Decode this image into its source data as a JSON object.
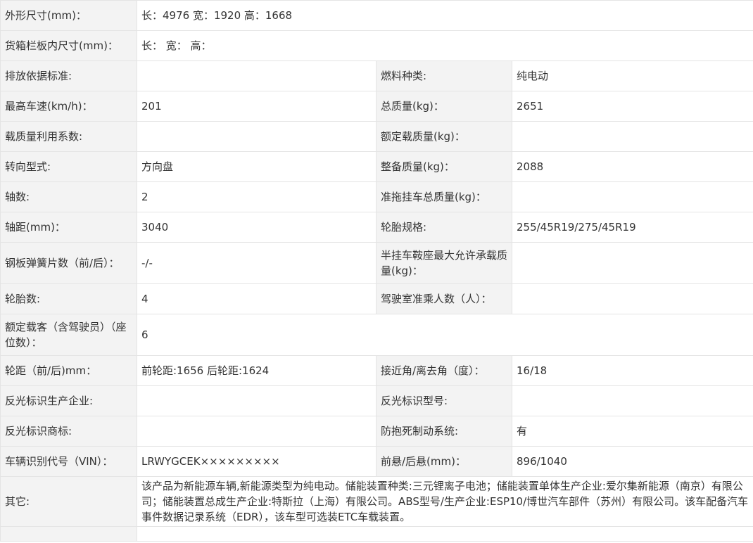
{
  "rows": [
    {
      "type": "span",
      "label": "外形尺寸(mm)：",
      "value": "长：4976 宽：1920 高：1668"
    },
    {
      "type": "span",
      "label": "货箱栏板内尺寸(mm)：",
      "value": "长： 宽： 高："
    },
    {
      "type": "pair",
      "label1": "排放依据标准:",
      "value1": "",
      "label2": "燃料种类:",
      "value2": "纯电动"
    },
    {
      "type": "pair",
      "label1": "最高车速(km/h)：",
      "value1": "201",
      "label2": "总质量(kg)：",
      "value2": "2651"
    },
    {
      "type": "pair",
      "label1": "载质量利用系数:",
      "value1": "",
      "label2": "额定载质量(kg)：",
      "value2": ""
    },
    {
      "type": "pair",
      "label1": "转向型式:",
      "value1": "方向盘",
      "label2": "整备质量(kg)：",
      "value2": "2088"
    },
    {
      "type": "pair",
      "label1": "轴数:",
      "value1": "2",
      "label2": "准拖挂车总质量(kg)：",
      "value2": ""
    },
    {
      "type": "pair",
      "label1": "轴距(mm)：",
      "value1": "3040",
      "label2": "轮胎规格:",
      "value2": "255/45R19/275/45R19"
    },
    {
      "type": "pair",
      "tall": true,
      "label1": "钢板弹簧片数（前/后）：",
      "value1": "-/-",
      "label2": "半挂车鞍座最大允许承载质量(kg)：",
      "value2": ""
    },
    {
      "type": "pair",
      "label1": "轮胎数:",
      "value1": "4",
      "label2": "驾驶室准乘人数（人）：",
      "value2": ""
    },
    {
      "type": "span",
      "tall": true,
      "label": "额定载客（含驾驶员）（座位数）：",
      "value": "6"
    },
    {
      "type": "pair",
      "label1": "轮距（前/后)mm：",
      "value1": "前轮距:1656 后轮距:1624",
      "label2": "接近角/离去角（度）：",
      "value2": "16/18"
    },
    {
      "type": "pair",
      "label1": "反光标识生产企业:",
      "value1": "",
      "label2": "反光标识型号:",
      "value2": ""
    },
    {
      "type": "pair",
      "label1": "反光标识商标:",
      "value1": "",
      "label2": "防抱死制动系统:",
      "value2": "有"
    },
    {
      "type": "pair",
      "label1": "车辆识别代号（VIN）：",
      "value1": "LRWYGCEK×××××××××",
      "label2": "前悬/后悬(mm)：",
      "value2": "896/1040"
    },
    {
      "type": "span",
      "taller": true,
      "label": "其它:",
      "value": "该产品为新能源车辆,新能源类型为纯电动。储能装置种类:三元锂离子电池；储能装置单体生产企业:爱尔集新能源（南京）有限公司；储能装置总成生产企业:特斯拉（上海）有限公司。ABS型号/生产企业:ESP10/博世汽车部件（苏州）有限公司。该车配备汽车事件数据记录系统（EDR），该车型可选装ETC车载装置。"
    }
  ]
}
